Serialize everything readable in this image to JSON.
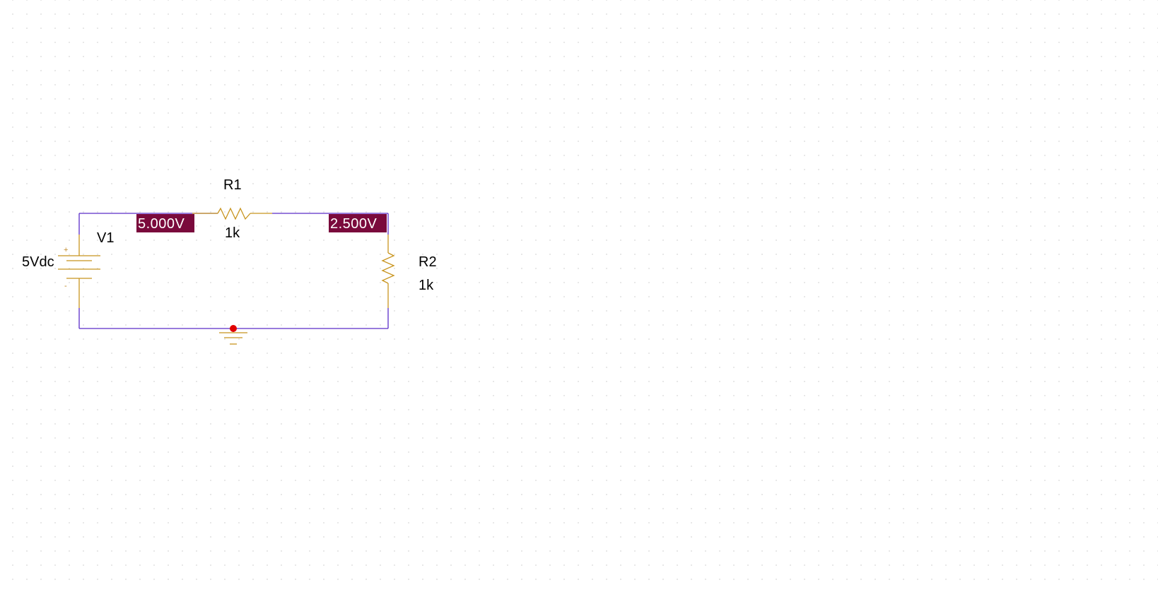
{
  "schematic": {
    "source": {
      "ref": "V1",
      "value": "5Vdc",
      "plus_mark": "+",
      "minus_mark": "-"
    },
    "r1": {
      "ref": "R1",
      "value": "1k"
    },
    "r2": {
      "ref": "R2",
      "value": "1k"
    },
    "voltage_probes": {
      "node_top_left": "5.000V",
      "node_top_right": "2.500V"
    },
    "colors": {
      "wire": "#5a2cc8",
      "part": "#c8941e",
      "probe_background": "#7a0a3c",
      "probe_text": "#ffffff",
      "ground_node": "#e00000",
      "grid_dot": "#d4d4d4"
    }
  }
}
